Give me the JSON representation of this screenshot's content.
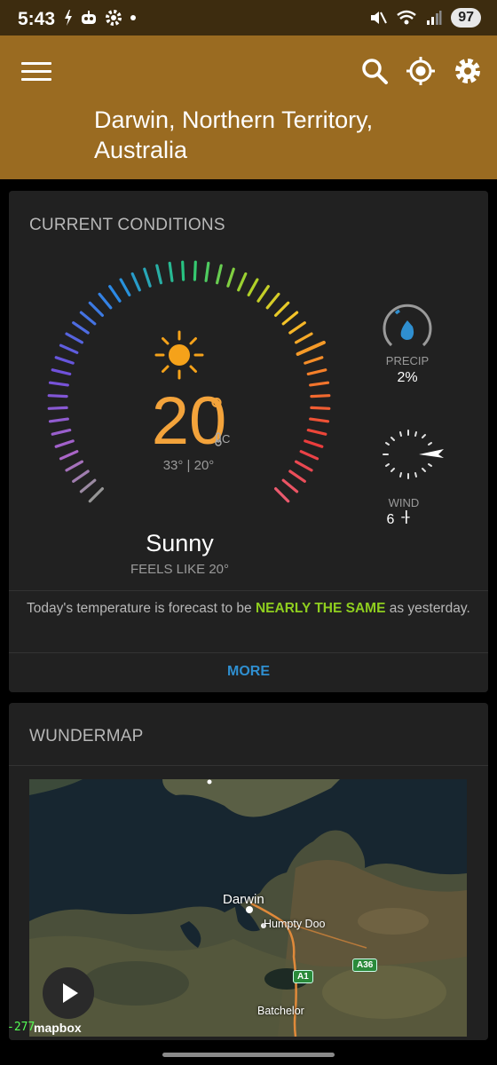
{
  "status_bar": {
    "time": "5:43",
    "battery": "97"
  },
  "app_bar": {
    "location": "Darwin, Northern Territory, Australia"
  },
  "current_conditions": {
    "title": "CURRENT CONDITIONS",
    "temperature": "20",
    "degree_symbol": "°",
    "unit": "C",
    "hi_lo": "33° | 20°",
    "condition": "Sunny",
    "feels_like": "FEELS LIKE 20°",
    "precip_label": "PRECIP",
    "precip_value": "2%",
    "wind_label": "WIND",
    "wind_value": "6",
    "wind_gust": "--",
    "forecast_before": "Today's temperature is forecast to be ",
    "forecast_highlight": "NEARLY THE SAME",
    "forecast_after": " as yesterday.",
    "more_label": "MORE",
    "highlight_color": "#8fce1f",
    "accent_temp_color": "#f3a33b"
  },
  "wundermap": {
    "title": "WUNDERMAP",
    "labels": {
      "city": "Darwin",
      "town1": "Humpty Doo",
      "town2": "Batchelor"
    },
    "roads": {
      "road1": "A1",
      "road2": "A36"
    },
    "attribution": "mapbox",
    "coordinate": "-277"
  }
}
